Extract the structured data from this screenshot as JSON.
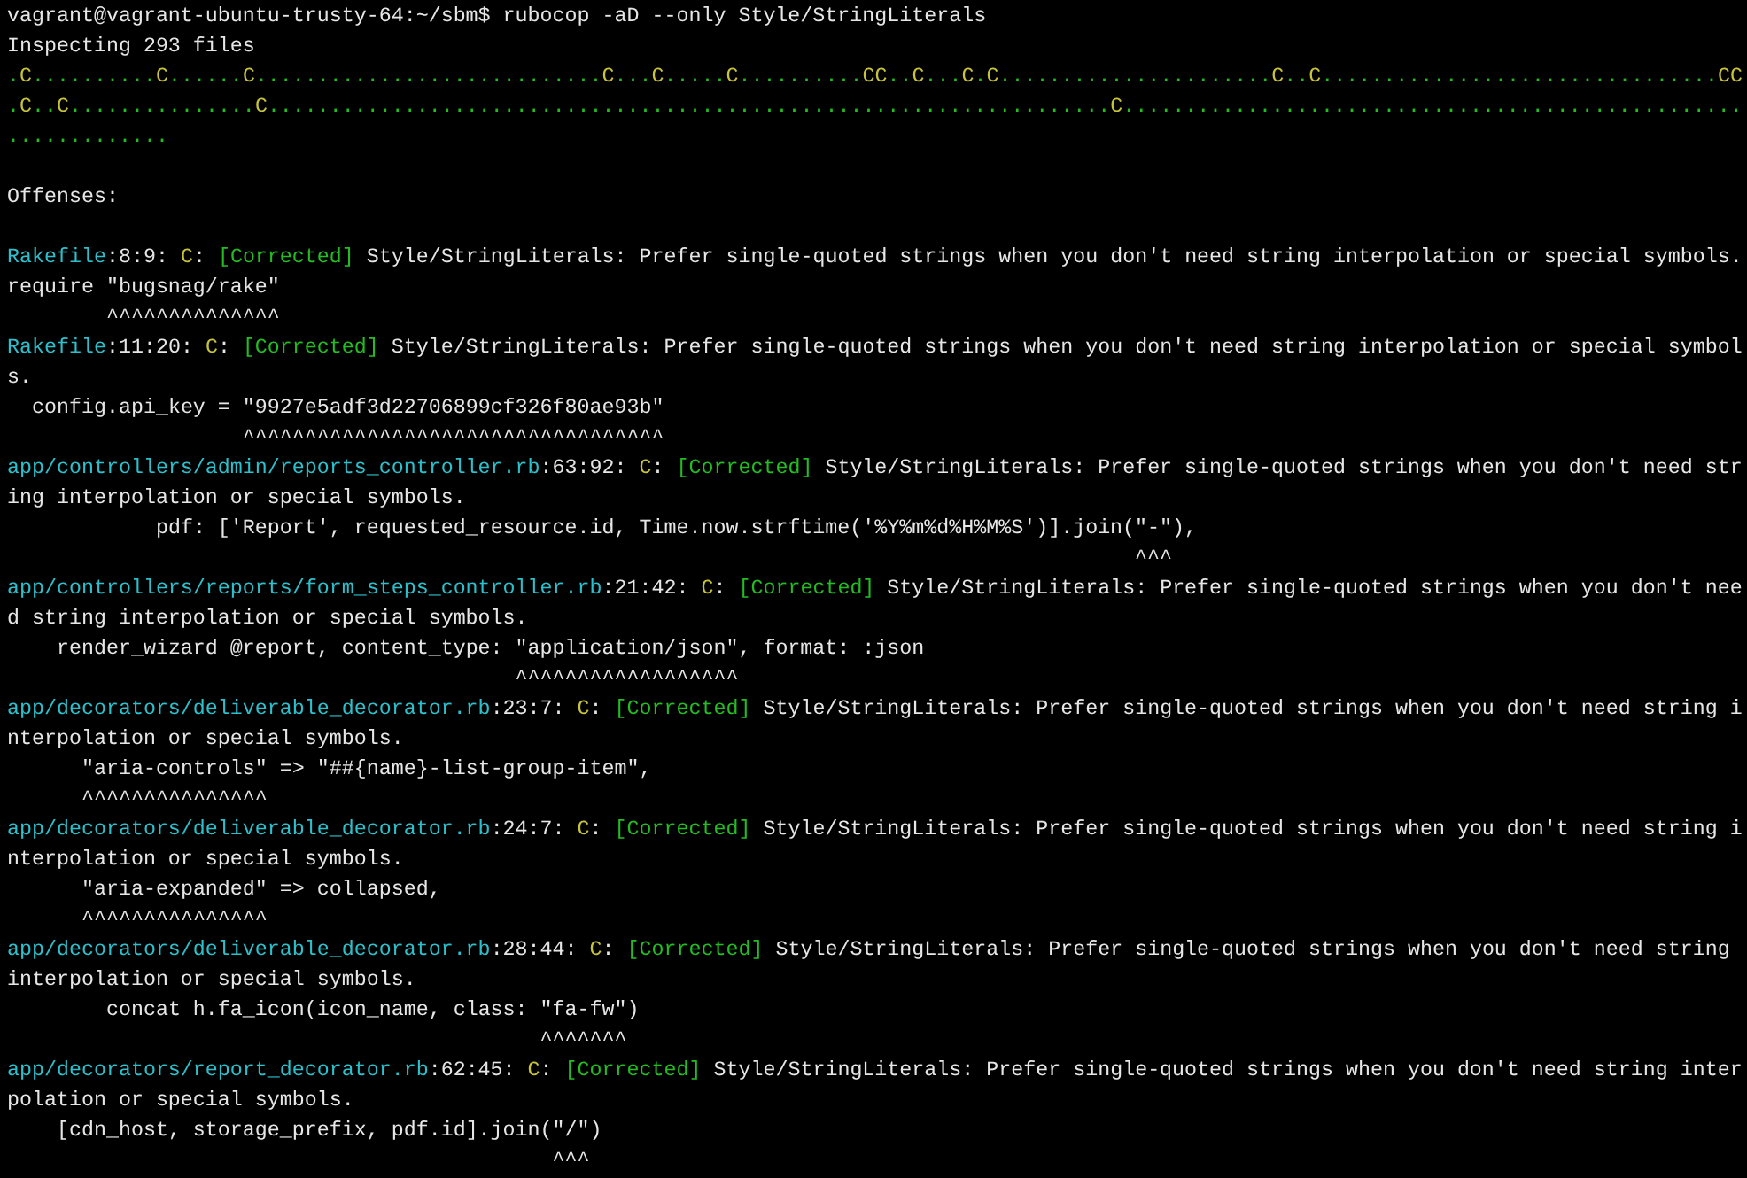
{
  "command_line": "vagrant@vagrant-ubuntu-trusty-64:~/sbm$ rubocop -aD --only Style/StringLiterals",
  "summary": "Inspecting 293 files",
  "progress": [
    {
      "kind": "ok",
      "text": "."
    },
    {
      "kind": "corrected",
      "text": "C"
    },
    {
      "kind": "ok",
      "text": ".........."
    },
    {
      "kind": "corrected",
      "text": "C"
    },
    {
      "kind": "ok",
      "text": "......"
    },
    {
      "kind": "corrected",
      "text": "C"
    },
    {
      "kind": "ok",
      "text": "............................"
    },
    {
      "kind": "corrected",
      "text": "C"
    },
    {
      "kind": "ok",
      "text": "..."
    },
    {
      "kind": "corrected",
      "text": "C"
    },
    {
      "kind": "ok",
      "text": "....."
    },
    {
      "kind": "corrected",
      "text": "C"
    },
    {
      "kind": "ok",
      "text": ".........."
    },
    {
      "kind": "corrected",
      "text": "CC"
    },
    {
      "kind": "ok",
      "text": ".."
    },
    {
      "kind": "corrected",
      "text": "C"
    },
    {
      "kind": "ok",
      "text": "..."
    },
    {
      "kind": "corrected",
      "text": "C"
    },
    {
      "kind": "ok",
      "text": "."
    },
    {
      "kind": "corrected",
      "text": "C"
    },
    {
      "kind": "ok",
      "text": "......................"
    },
    {
      "kind": "corrected",
      "text": "C"
    },
    {
      "kind": "ok",
      "text": ".."
    },
    {
      "kind": "corrected",
      "text": "C"
    },
    {
      "kind": "ok",
      "text": "................................"
    },
    {
      "kind": "corrected",
      "text": "CC"
    },
    {
      "kind": "ok",
      "text": "."
    },
    {
      "kind": "corrected",
      "text": "C"
    },
    {
      "kind": "ok",
      "text": ".."
    },
    {
      "kind": "corrected",
      "text": "C"
    },
    {
      "kind": "ok",
      "text": "..............."
    },
    {
      "kind": "corrected",
      "text": "C"
    },
    {
      "kind": "ok",
      "text": "...................................................................."
    },
    {
      "kind": "corrected",
      "text": "C"
    },
    {
      "kind": "ok",
      "text": "..............................................................."
    }
  ],
  "offenses_heading": "Offenses:",
  "offenses": [
    {
      "header": [
        {
          "kind": "file",
          "text": "Rakefile"
        },
        {
          "kind": "plain",
          "text": ":8:9: "
        },
        {
          "kind": "severity",
          "text": "C"
        },
        {
          "kind": "plain",
          "text": ": "
        },
        {
          "kind": "status",
          "text": "[Corrected]"
        },
        {
          "kind": "plain",
          "text": " Style/StringLiterals: Prefer single-quoted strings when you don't need string interpolation or special symbols."
        }
      ],
      "source": "require \"bugsnag/rake\"",
      "marker": "        ^^^^^^^^^^^^^^"
    },
    {
      "header": [
        {
          "kind": "file",
          "text": "Rakefile"
        },
        {
          "kind": "plain",
          "text": ":11:20: "
        },
        {
          "kind": "severity",
          "text": "C"
        },
        {
          "kind": "plain",
          "text": ": "
        },
        {
          "kind": "status",
          "text": "[Corrected]"
        },
        {
          "kind": "plain",
          "text": " Style/StringLiterals: Prefer single-quoted strings when you don't need string interpolation or special symbols."
        }
      ],
      "source": "  config.api_key = \"9927e5adf3d22706899cf326f80ae93b\"",
      "marker": "                   ^^^^^^^^^^^^^^^^^^^^^^^^^^^^^^^^^^"
    },
    {
      "header": [
        {
          "kind": "file",
          "text": "app/controllers/admin/reports_controller.rb"
        },
        {
          "kind": "plain",
          "text": ":63:92: "
        },
        {
          "kind": "severity",
          "text": "C"
        },
        {
          "kind": "plain",
          "text": ": "
        },
        {
          "kind": "status",
          "text": "[Corrected]"
        },
        {
          "kind": "plain",
          "text": " Style/StringLiterals: Prefer single-quoted strings when you don't need string interpolation or special symbols."
        }
      ],
      "source": "            pdf: ['Report', requested_resource.id, Time.now.strftime('%Y%m%d%H%M%S')].join(\"-\"),",
      "marker": "                                                                                           ^^^"
    },
    {
      "header": [
        {
          "kind": "file",
          "text": "app/controllers/reports/form_steps_controller.rb"
        },
        {
          "kind": "plain",
          "text": ":21:42: "
        },
        {
          "kind": "severity",
          "text": "C"
        },
        {
          "kind": "plain",
          "text": ": "
        },
        {
          "kind": "status",
          "text": "[Corrected]"
        },
        {
          "kind": "plain",
          "text": " Style/StringLiterals: Prefer single-quoted strings when you don't need string interpolation or special symbols."
        }
      ],
      "source": "    render_wizard @report, content_type: \"application/json\", format: :json",
      "marker": "                                         ^^^^^^^^^^^^^^^^^^"
    },
    {
      "header": [
        {
          "kind": "file",
          "text": "app/decorators/deliverable_decorator.rb"
        },
        {
          "kind": "plain",
          "text": ":23:7: "
        },
        {
          "kind": "severity",
          "text": "C"
        },
        {
          "kind": "plain",
          "text": ": "
        },
        {
          "kind": "status",
          "text": "[Corrected]"
        },
        {
          "kind": "plain",
          "text": " Style/StringLiterals: Prefer single-quoted strings when you don't need string interpolation or special symbols."
        }
      ],
      "source": "      \"aria-controls\" => \"##{name}-list-group-item\",",
      "marker": "      ^^^^^^^^^^^^^^^"
    },
    {
      "header": [
        {
          "kind": "file",
          "text": "app/decorators/deliverable_decorator.rb"
        },
        {
          "kind": "plain",
          "text": ":24:7: "
        },
        {
          "kind": "severity",
          "text": "C"
        },
        {
          "kind": "plain",
          "text": ": "
        },
        {
          "kind": "status",
          "text": "[Corrected]"
        },
        {
          "kind": "plain",
          "text": " Style/StringLiterals: Prefer single-quoted strings when you don't need string interpolation or special symbols."
        }
      ],
      "source": "      \"aria-expanded\" => collapsed,",
      "marker": "      ^^^^^^^^^^^^^^^"
    },
    {
      "header": [
        {
          "kind": "file",
          "text": "app/decorators/deliverable_decorator.rb"
        },
        {
          "kind": "plain",
          "text": ":28:44: "
        },
        {
          "kind": "severity",
          "text": "C"
        },
        {
          "kind": "plain",
          "text": ": "
        },
        {
          "kind": "status",
          "text": "[Corrected]"
        },
        {
          "kind": "plain",
          "text": " Style/StringLiterals: Prefer single-quoted strings when you don't need string interpolation or special symbols."
        }
      ],
      "source": "        concat h.fa_icon(icon_name, class: \"fa-fw\")",
      "marker": "                                           ^^^^^^^"
    },
    {
      "header": [
        {
          "kind": "file",
          "text": "app/decorators/report_decorator.rb"
        },
        {
          "kind": "plain",
          "text": ":62:45: "
        },
        {
          "kind": "severity",
          "text": "C"
        },
        {
          "kind": "plain",
          "text": ": "
        },
        {
          "kind": "status",
          "text": "[Corrected]"
        },
        {
          "kind": "plain",
          "text": " Style/StringLiterals: Prefer single-quoted strings when you don't need string interpolation or special symbols."
        }
      ],
      "source": "    [cdn_host, storage_prefix, pdf.id].join(\"/\")",
      "marker": "                                            ^^^"
    }
  ]
}
